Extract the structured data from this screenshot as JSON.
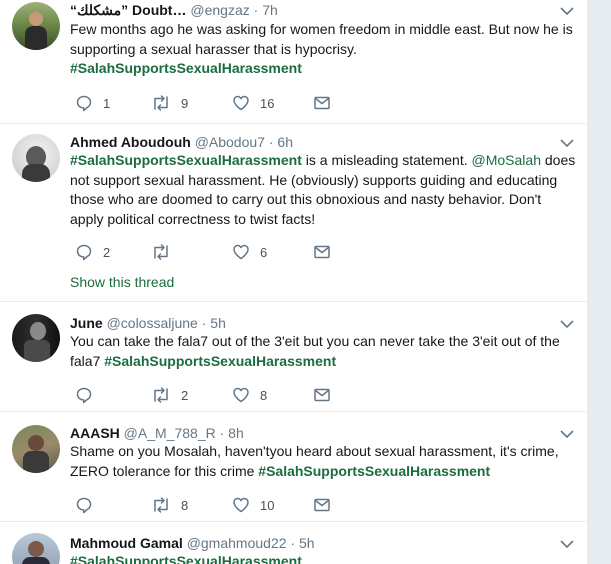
{
  "tweets": [
    {
      "name": "“مشكلك” Doubt…",
      "handle": "@engzaz",
      "time": "7h",
      "text_plain": "Few months ago he was asking for women freedom in middle east. But now he is supporting a sexual harasser that is hypocrisy.",
      "hashtag": "#SalahSupportsSexualHarassment",
      "replies": "1",
      "retweets": "9",
      "likes": "16"
    },
    {
      "name": "Ahmed Aboudouh",
      "handle": "@Abodou7",
      "time": "6h",
      "hashtag": "#SalahSupportsSexualHarassment",
      "text_after_hashtag": " is a misleading statement. ",
      "mention": "@MoSalah",
      "text_rest": " does not support sexual harassment. He (obviously) supports guiding and educating those who are doomed to carry out this obnoxious and nasty behavior. Don't apply political correctness to twist facts!",
      "replies": "2",
      "retweets": "",
      "likes": "6",
      "show_thread": "Show this thread"
    },
    {
      "name": "June",
      "handle": "@colossaljune",
      "time": "5h",
      "text_plain": "You can take the fala7 out of the 3'eit but you can never take the 3'eit out of the fala7 ",
      "hashtag": "#SalahSupportsSexualHarassment",
      "replies": "",
      "retweets": "2",
      "likes": "8"
    },
    {
      "name": "AAASH",
      "handle": "@A_M_788_R",
      "time": "8h",
      "text_plain": "Shame on you Mosalah, haven'tyou heard about sexual harassment, it's crime, ZERO tolerance for this crime ",
      "hashtag": "#SalahSupportsSexualHarassment",
      "replies": "",
      "retweets": "8",
      "likes": "10"
    },
    {
      "name": "Mahmoud Gamal",
      "handle": "@gmahmoud22",
      "time": "5h",
      "hashtag": "#SalahSupportsSexualHarassment"
    }
  ],
  "separator": "·",
  "colors": {
    "link": "#1b6c3f",
    "muted": "#657786",
    "border": "#e6ecf0"
  },
  "icons": [
    "reply-icon",
    "retweet-icon",
    "like-icon",
    "direct-message-icon",
    "caret-down-icon"
  ]
}
